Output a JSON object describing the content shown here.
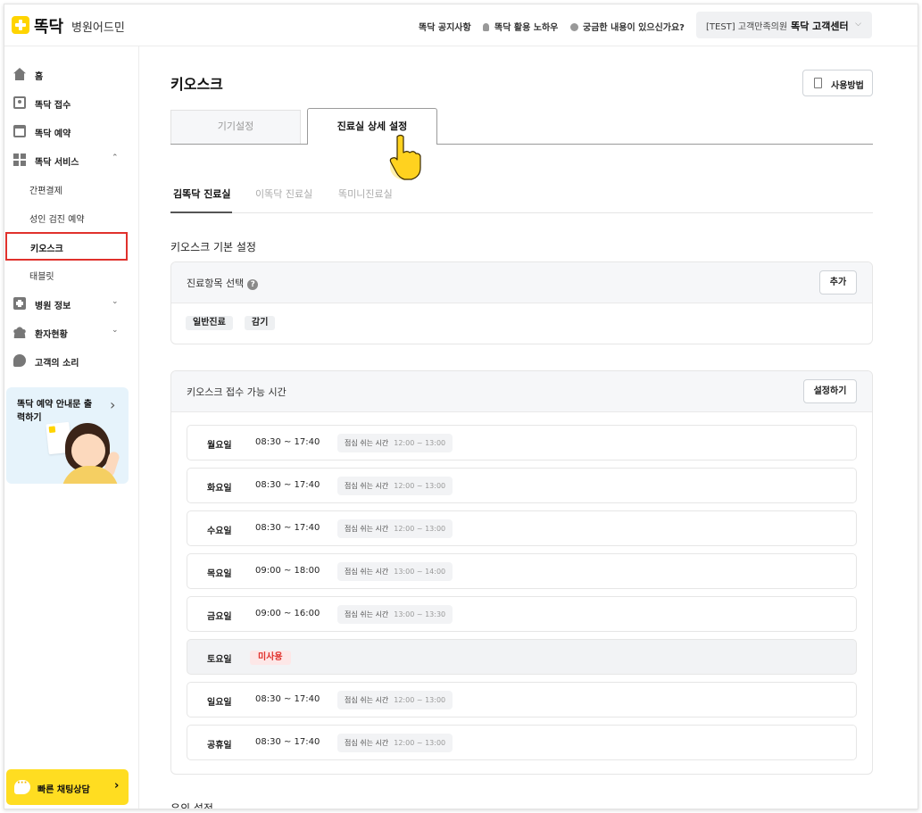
{
  "header": {
    "brand": "똑닥",
    "brand_sub": "병원어드민",
    "nav": [
      "똑닥 공지사항",
      "똑닥 활용 노하우",
      "궁금한 내용이 있으신가요?"
    ],
    "hospital_name": "[TEST] 고객만족의원",
    "support_label": "똑닥 고객센터",
    "chevron": "⌵"
  },
  "sidebar": {
    "items": [
      {
        "label": "홈",
        "icon": "home-icon"
      },
      {
        "label": "똑닥 접수",
        "icon": "person-card-icon"
      },
      {
        "label": "똑닥 예약",
        "icon": "calendar-icon"
      },
      {
        "label": "똑닥 서비스",
        "icon": "grid-icon",
        "arrow": "⌃"
      }
    ],
    "sub_items": [
      "간편결제",
      "성인 검진 예약",
      "키오스크",
      "태블릿"
    ],
    "items_bottom": [
      {
        "label": "병원 정보",
        "icon": "hospital-icon",
        "arrow": "⌄"
      },
      {
        "label": "환자현황",
        "icon": "users-icon",
        "arrow": "⌄"
      },
      {
        "label": "고객의 소리",
        "icon": "chat-icon"
      }
    ],
    "banner_text": "똑닥 예약 안내문 출력하기",
    "banner_chevron": "›",
    "chat_label": "빠른 채팅상담",
    "chat_chevron": "›"
  },
  "main": {
    "title": "키오스크",
    "howto_label": "사용방법",
    "tabs": [
      "기기설정",
      "진료실 상세 설정"
    ],
    "subtabs": [
      "김똑닥 진료실",
      "이똑닥 진료실",
      "똑미니진료실"
    ],
    "section_title": "키오스크 기본 설정",
    "treatment": {
      "title": "진료항목 선택",
      "help": "?",
      "add_label": "추가",
      "chips": [
        "일반진료",
        "감기"
      ]
    },
    "hours": {
      "title": "키오스크 접수 가능 시간",
      "setup_label": "설정하기",
      "lunch_label": "점심 쉬는 시간",
      "unused_label": "미사용",
      "days": [
        {
          "day": "월요일",
          "time": "08:30 ~ 17:40",
          "lunch": "12:00 ~ 13:00"
        },
        {
          "day": "화요일",
          "time": "08:30 ~ 17:40",
          "lunch": "12:00 ~ 13:00"
        },
        {
          "day": "수요일",
          "time": "08:30 ~ 17:40",
          "lunch": "12:00 ~ 13:00"
        },
        {
          "day": "목요일",
          "time": "09:00 ~ 18:00",
          "lunch": "13:00 ~ 14:00"
        },
        {
          "day": "금요일",
          "time": "09:00 ~ 16:00",
          "lunch": "13:00 ~ 13:30"
        },
        {
          "day": "토요일",
          "time": "",
          "lunch": ""
        },
        {
          "day": "일요일",
          "time": "08:30 ~ 17:40",
          "lunch": "12:00 ~ 13:00"
        },
        {
          "day": "공휴일",
          "time": "08:30 ~ 17:40",
          "lunch": "12:00 ~ 13:00"
        }
      ]
    },
    "next_section_title": "유의 설정"
  },
  "colors": {
    "brand_yellow": "#ffd400",
    "active_outline": "#e0312c",
    "unused_red": "#e0312c"
  }
}
